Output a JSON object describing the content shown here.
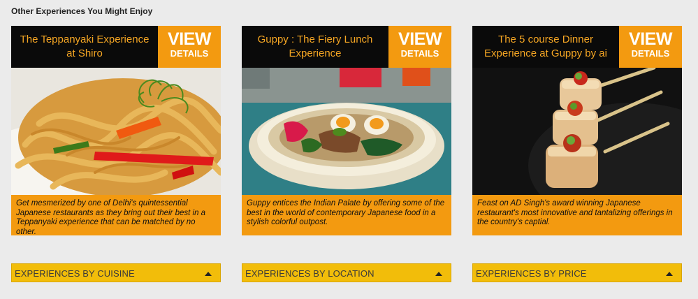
{
  "section": {
    "title": "Other Experiences You Might Enjoy"
  },
  "cards": [
    {
      "title": "The Teppanyaki Experience at Shiro",
      "view_label": "VIEW",
      "details_label": "DETAILS",
      "image": "noodle-dish-photo",
      "description": "Get mesmerized by one of Delhi's quintessential Japanese restaurants as they bring out their best in a Teppanyaki experience that can be matched by no other."
    },
    {
      "title": "Guppy : The Fiery Lunch Experience",
      "view_label": "VIEW",
      "details_label": "DETAILS",
      "image": "ramen-bowl-photo",
      "description": "Guppy entices the Indian Palate by offering some of the best in the world of contemporary Japanese food in a stylish colorful outpost."
    },
    {
      "title": "The 5 course Dinner Experience at Guppy by ai",
      "view_label": "VIEW",
      "details_label": "DETAILS",
      "image": "tofu-skewers-photo",
      "description": "Feast on AD Singh's award winning Japanese restaurant's most innovative and tantalizing offerings in the country's captial."
    }
  ],
  "accordions": [
    {
      "label": "EXPERIENCES BY CUISINE",
      "icon": "triangle-up-icon"
    },
    {
      "label": "EXPERIENCES BY LOCATION",
      "icon": "triangle-up-icon"
    },
    {
      "label": "EXPERIENCES BY PRICE",
      "icon": "triangle-up-icon"
    }
  ],
  "colors": {
    "accent": "#f39a10",
    "title_text": "#f5a623",
    "header_bg": "#0a0a0a",
    "accordion_bg": "#f2bd0a",
    "page_bg": "#ebebeb"
  }
}
